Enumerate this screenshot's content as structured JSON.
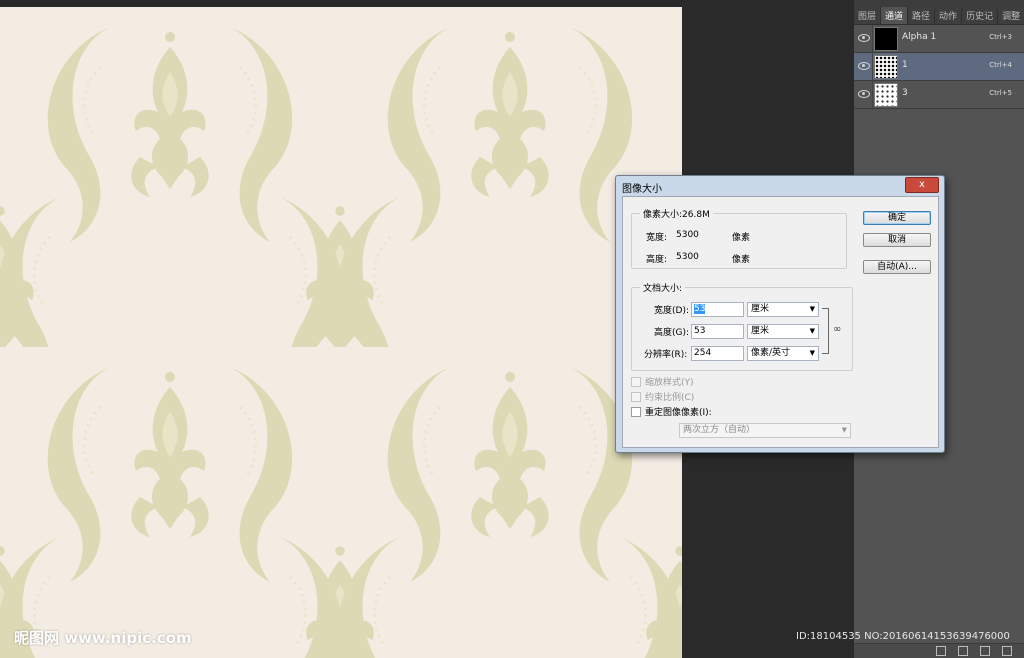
{
  "canvas": {
    "pattern": "damask",
    "bg_color": "#f3ece3",
    "motif_color": "#ddd9b5"
  },
  "panel": {
    "tabs": [
      "图层",
      "通道",
      "路径",
      "动作",
      "历史记",
      "调整"
    ],
    "active_tab": 1,
    "channels": [
      {
        "name": "Alpha 1",
        "shortcut": "Ctrl+3",
        "thumb": "black",
        "selected": false
      },
      {
        "name": "1",
        "shortcut": "Ctrl+4",
        "thumb": "pattern",
        "selected": true
      },
      {
        "name": "3",
        "shortcut": "Ctrl+5",
        "thumb": "pattern-light",
        "selected": false
      }
    ]
  },
  "dialog": {
    "title": "图像大小",
    "close_glyph": "x",
    "pixel_size_label": "像素大小:26.8M",
    "width_label": "宽度:",
    "width_value": "5300",
    "height_label": "高度:",
    "height_value": "5300",
    "pixel_unit": "像素",
    "doc_size_label": "文档大小:",
    "doc_width_label": "宽度(D):",
    "doc_width_value": "53",
    "doc_height_label": "高度(G):",
    "doc_height_value": "53",
    "resolution_label": "分辨率(R):",
    "resolution_value": "254",
    "unit_cm": "厘米",
    "unit_resolution": "像素/英寸",
    "scale_styles": "缩放样式(Y)",
    "constrain": "约束比例(C)",
    "resample": "重定图像像素(I):",
    "resample_method": "两次立方（自动）",
    "ok": "确定",
    "cancel": "取消",
    "auto": "自动(A)..."
  },
  "watermarks": {
    "left": "昵图网 www.nipic.com",
    "right": "ID:18104535 NO:20160614153639476000"
  }
}
